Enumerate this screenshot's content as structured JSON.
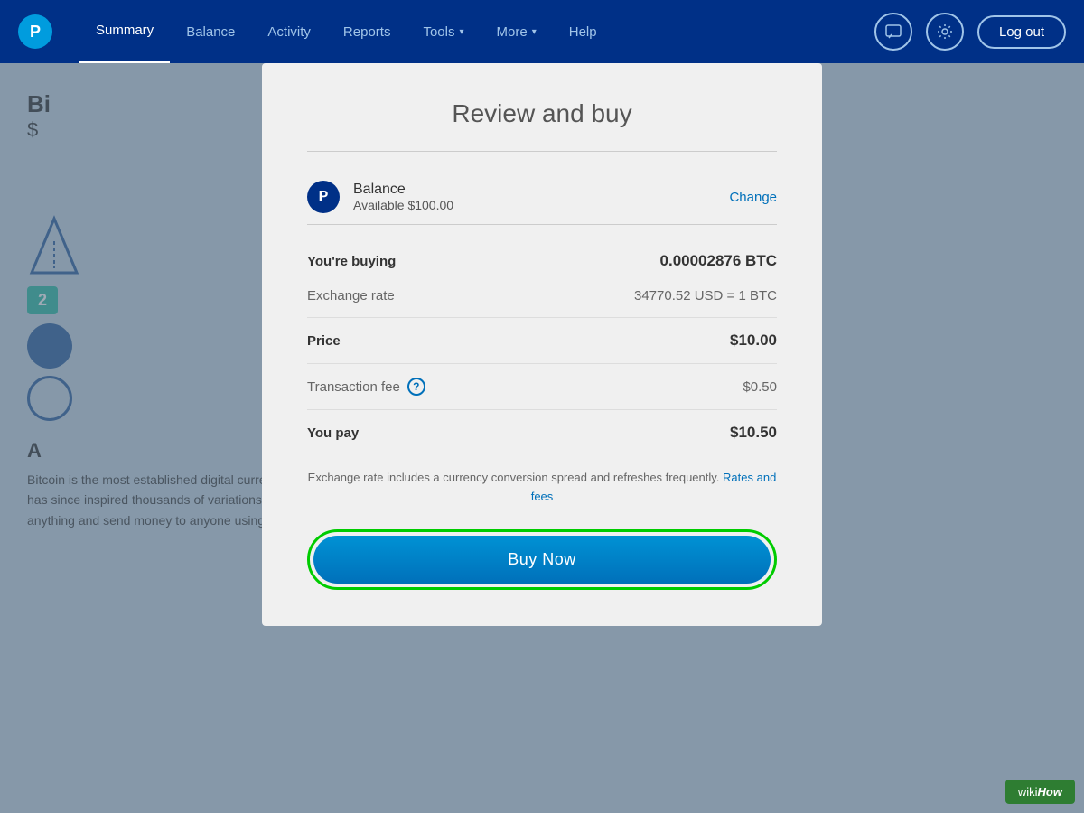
{
  "navbar": {
    "logo_letter": "P",
    "items": [
      {
        "label": "Summary",
        "active": true
      },
      {
        "label": "Balance",
        "active": false
      },
      {
        "label": "Activity",
        "active": false
      },
      {
        "label": "Reports",
        "active": false
      },
      {
        "label": "Tools",
        "active": false,
        "has_dropdown": true
      },
      {
        "label": "More",
        "active": false,
        "has_dropdown": true
      },
      {
        "label": "Help",
        "active": false
      }
    ],
    "logout_label": "Log out"
  },
  "background": {
    "heading": "A",
    "price_text": "$",
    "badge_number": "2",
    "section_heading": "A",
    "paragraph": "Bitcoin is the most established digital currency. It is comonly used as cash and credit. It set off a revolution that has since inspired thousands of variations on the original. Someday soon, you might be able to buy just about anything and send money to anyone using bitcoins and other"
  },
  "modal": {
    "title": "Review and buy",
    "payment_method": {
      "name": "Balance",
      "available": "Available $100.00",
      "change_label": "Change"
    },
    "buying_label": "You're buying",
    "buying_value": "0.00002876 BTC",
    "exchange_rate_label": "Exchange rate",
    "exchange_rate_value": "34770.52 USD = 1 BTC",
    "price_label": "Price",
    "price_value": "$10.00",
    "transaction_fee_label": "Transaction fee",
    "transaction_fee_value": "$0.50",
    "you_pay_label": "You pay",
    "you_pay_value": "$10.50",
    "note_text": "Exchange rate includes a currency conversion spread and refreshes frequently.",
    "rates_link": "Rates and fees",
    "buy_button_label": "Buy Now"
  },
  "wikihow": {
    "label": "wikiHow"
  }
}
